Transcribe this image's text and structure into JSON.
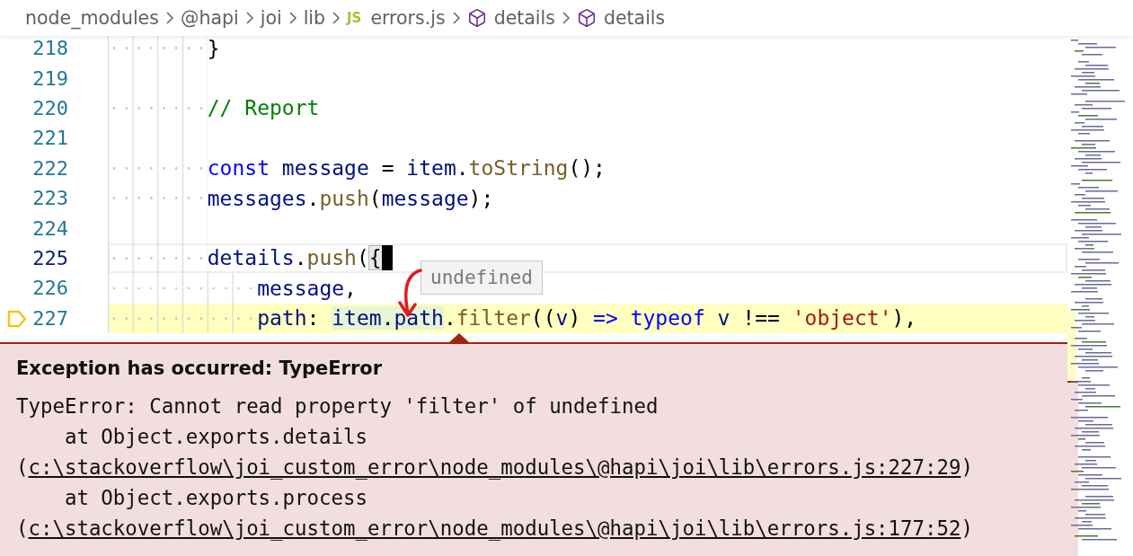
{
  "breadcrumb": [
    {
      "kind": "folder",
      "text": "node_modules"
    },
    {
      "kind": "folder",
      "text": "@hapi"
    },
    {
      "kind": "folder",
      "text": "joi"
    },
    {
      "kind": "folder",
      "text": "lib"
    },
    {
      "kind": "js-file",
      "badge": "JS",
      "text": "errors.js"
    },
    {
      "kind": "symbol",
      "text": "details"
    },
    {
      "kind": "symbol",
      "text": "details"
    }
  ],
  "editor": {
    "lines": [
      {
        "number": "218",
        "current": false,
        "paused": false,
        "tokens": [
          {
            "kind": "plain",
            "text": "}"
          }
        ]
      },
      {
        "number": "219",
        "current": false,
        "paused": false
      },
      {
        "number": "220",
        "current": false,
        "paused": false,
        "tokens": [
          {
            "kind": "comment",
            "text": "// Report"
          }
        ]
      },
      {
        "number": "221",
        "current": false,
        "paused": false
      },
      {
        "number": "222",
        "current": false,
        "paused": false,
        "tokens": [
          {
            "kind": "keyword",
            "text": "const"
          },
          {
            "kind": "variable",
            "text": " message"
          },
          {
            "kind": "plain",
            "text": " = "
          },
          {
            "kind": "variable",
            "text": "item"
          },
          {
            "kind": "plain",
            "text": "."
          },
          {
            "kind": "function",
            "text": "toString"
          },
          {
            "kind": "plain",
            "text": "();"
          }
        ]
      },
      {
        "number": "223",
        "current": false,
        "paused": false,
        "tokens": [
          {
            "kind": "variable",
            "text": "messages"
          },
          {
            "kind": "plain",
            "text": "."
          },
          {
            "kind": "function",
            "text": "push"
          },
          {
            "kind": "plain",
            "text": "("
          },
          {
            "kind": "variable",
            "text": "message"
          },
          {
            "kind": "plain",
            "text": ");"
          }
        ]
      },
      {
        "number": "224",
        "current": false,
        "paused": false
      },
      {
        "number": "225",
        "current": true,
        "paused": false,
        "tokens": [
          {
            "kind": "variable",
            "text": "details"
          },
          {
            "kind": "plain",
            "text": "."
          },
          {
            "kind": "function",
            "text": "push"
          },
          {
            "kind": "plain",
            "text": "("
          },
          {
            "kind": "bracket",
            "text": "{"
          }
        ],
        "children": [
          {
            "number": "226",
            "current": false,
            "paused": false,
            "tokens": [
              {
                "kind": "variable",
                "text": "message"
              },
              {
                "kind": "plain",
                "text": ","
              }
            ]
          },
          {
            "number": "227",
            "current": false,
            "paused": true,
            "tokens": [
              {
                "kind": "variable",
                "text": "path"
              },
              {
                "kind": "plain",
                "text": ": "
              },
              {
                "kind": "variable",
                "text": "item",
                "hovered": true
              },
              {
                "kind": "plain",
                "text": ".",
                "hovered": true
              },
              {
                "kind": "variable",
                "text": "path",
                "hovered": true
              },
              {
                "kind": "plain",
                "text": "."
              },
              {
                "kind": "function",
                "text": "filter"
              },
              {
                "kind": "plain",
                "text": "(("
              },
              {
                "kind": "variable",
                "text": "v"
              },
              {
                "kind": "plain",
                "text": ") "
              },
              {
                "kind": "keyword",
                "text": "=>"
              },
              {
                "kind": "keyword",
                "text": " typeof"
              },
              {
                "kind": "variable",
                "text": " v"
              },
              {
                "kind": "plain",
                "text": " !== "
              },
              {
                "kind": "string",
                "text": "'object'"
              },
              {
                "kind": "plain",
                "text": "),"
              }
            ]
          }
        ]
      }
    ],
    "hover_tooltip": "undefined"
  },
  "exception": {
    "title": "Exception has occurred: TypeError",
    "trace": [
      [
        {
          "kind": "plain",
          "text": "TypeError: Cannot read property 'filter' of undefined"
        }
      ],
      [
        {
          "kind": "plain",
          "text": "    at Object.exports.details"
        }
      ],
      [
        {
          "kind": "plain",
          "text": "("
        },
        {
          "kind": "link",
          "text": "c:\\stackoverflow\\joi_custom_error\\node_modules\\@hapi\\joi\\lib\\errors.js:227:29"
        },
        {
          "kind": "plain",
          "text": ")"
        }
      ],
      [
        {
          "kind": "plain",
          "text": "    at Object.exports.process"
        }
      ],
      [
        {
          "kind": "plain",
          "text": "("
        },
        {
          "kind": "link",
          "text": "c:\\stackoverflow\\joi_custom_error\\node_modules\\@hapi\\joi\\lib\\errors.js:177:52"
        },
        {
          "kind": "plain",
          "text": ")"
        }
      ]
    ]
  }
}
